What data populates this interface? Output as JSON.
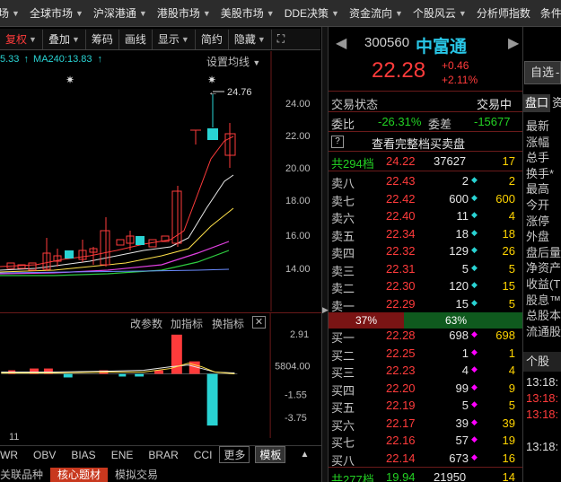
{
  "topbar": {
    "tabs": [
      {
        "label": "场",
        "caret": true
      },
      {
        "label": "全球市场",
        "caret": true
      },
      {
        "label": "沪深港通",
        "caret": true
      },
      {
        "label": "港股市场",
        "caret": true
      },
      {
        "label": "美股市场",
        "caret": true
      },
      {
        "label": "DDE决策",
        "caret": true
      },
      {
        "label": "资金流向",
        "caret": true
      },
      {
        "label": "个股风云",
        "caret": true
      },
      {
        "label": "分析师指数",
        "caret": false
      },
      {
        "label": "条件",
        "caret": false
      }
    ]
  },
  "toolbar": {
    "buttons": [
      "复权",
      "叠加",
      "筹码",
      "画线",
      "显示",
      "简约",
      "隐藏"
    ],
    "fuquan": "复权",
    "overlay": "叠加",
    "chips": "筹码",
    "draw": "画线",
    "display": "显示",
    "simple": "简约",
    "hide": "隐藏"
  },
  "main_chart": {
    "ma_legend_left": "5.33",
    "ma_legend": "MA240:13.83",
    "set_ma": "设置均线",
    "y_ticks": [
      "24.00",
      "22.00",
      "20.00",
      "18.00",
      "16.00",
      "14.00"
    ],
    "high_marker": "24.76"
  },
  "sub_chart": {
    "change_params": "改参数",
    "add_indicator": "加指标",
    "switch_indicator": "换指标",
    "close": "✕",
    "y_ticks": [
      "2.91",
      "5804.00",
      "-1.55",
      "-3.75"
    ]
  },
  "indicator_bar": {
    "left_label": "11",
    "items": [
      "WR",
      "OBV",
      "BIAS",
      "ENE",
      "BRAR",
      "CCI"
    ],
    "more": "更多",
    "template": "模板"
  },
  "bottom_tabs": [
    "关联品种",
    "核心题材",
    "模拟交易"
  ],
  "stock": {
    "code": "300560",
    "name": "中富通",
    "price": "22.28",
    "change": "+0.46",
    "change_pct": "+2.11%",
    "nav_prev": "◀",
    "nav_next": "▶"
  },
  "right_top_buttons": {
    "watchlist": "自选",
    "watchlist_caret": "-"
  },
  "trade_status": {
    "label": "交易状态",
    "value": "交易中"
  },
  "committee": {
    "ratio_label": "委比",
    "ratio": "-26.31%",
    "diff_label": "委差",
    "diff": "-15677"
  },
  "full_book": {
    "icon": "?",
    "label": "查看完整档买卖盘"
  },
  "sell_total": {
    "label": "共294档",
    "price": "24.22",
    "vol": "37627",
    "count": "17"
  },
  "asks": [
    {
      "label": "卖八",
      "price": "22.43",
      "vol": "2",
      "dot": true,
      "dot_color": "#29d3d3",
      "count": "2"
    },
    {
      "label": "卖七",
      "price": "22.42",
      "vol": "600",
      "dot": true,
      "dot_color": "#29d3d3",
      "count": "600"
    },
    {
      "label": "卖六",
      "price": "22.40",
      "vol": "11",
      "dot": true,
      "dot_color": "#29d3d3",
      "count": "4"
    },
    {
      "label": "卖五",
      "price": "22.34",
      "vol": "18",
      "dot": true,
      "dot_color": "#29d3d3",
      "count": "18"
    },
    {
      "label": "卖四",
      "price": "22.32",
      "vol": "129",
      "dot": true,
      "dot_color": "#29d3d3",
      "count": "26"
    },
    {
      "label": "卖三",
      "price": "22.31",
      "vol": "5",
      "dot": true,
      "dot_color": "#29d3d3",
      "count": "5"
    },
    {
      "label": "卖二",
      "price": "22.30",
      "vol": "120",
      "dot": true,
      "dot_color": "#29d3d3",
      "count": "15"
    },
    {
      "label": "卖一",
      "price": "22.29",
      "vol": "15",
      "dot": true,
      "dot_color": "#29d3d3",
      "count": "5"
    }
  ],
  "ratio_bar": {
    "left": "37%",
    "right": "63%"
  },
  "bids": [
    {
      "label": "买一",
      "price": "22.28",
      "vol": "698",
      "dot": true,
      "dot_color": "#ff00ff",
      "count": "698"
    },
    {
      "label": "买二",
      "price": "22.25",
      "vol": "1",
      "dot": true,
      "dot_color": "#ff00ff",
      "count": "1"
    },
    {
      "label": "买三",
      "price": "22.23",
      "vol": "4",
      "dot": true,
      "dot_color": "#ff00ff",
      "count": "4"
    },
    {
      "label": "买四",
      "price": "22.20",
      "vol": "99",
      "dot": true,
      "dot_color": "#ff00ff",
      "count": "9"
    },
    {
      "label": "买五",
      "price": "22.19",
      "vol": "5",
      "dot": true,
      "dot_color": "#ff00ff",
      "count": "5"
    },
    {
      "label": "买六",
      "price": "22.17",
      "vol": "39",
      "dot": true,
      "dot_color": "#ff00ff",
      "count": "39"
    },
    {
      "label": "买七",
      "price": "22.16",
      "vol": "57",
      "dot": true,
      "dot_color": "#ff00ff",
      "count": "19"
    },
    {
      "label": "买八",
      "price": "22.14",
      "vol": "673",
      "dot": true,
      "dot_color": "#ff00ff",
      "count": "16"
    }
  ],
  "buy_total": {
    "label": "共277档",
    "price": "19.94",
    "vol": "21950",
    "count": "14"
  },
  "far_right": {
    "tab1": "盘口",
    "tab2": "资",
    "items": [
      "最新",
      "涨幅",
      "总手",
      "换手*",
      "最高",
      "今开",
      "涨停",
      "外盘",
      "盘后量",
      "净资产",
      "收益(T",
      "股息™",
      "总股本",
      "流通股"
    ],
    "section": "个股",
    "times": [
      "13:18:",
      "13:18:",
      "13:18:",
      "13:18:"
    ]
  },
  "colors": {
    "up": "#ff3b3b",
    "down": "#23d123",
    "accent": "#29c6e6",
    "panel": "#000000"
  }
}
